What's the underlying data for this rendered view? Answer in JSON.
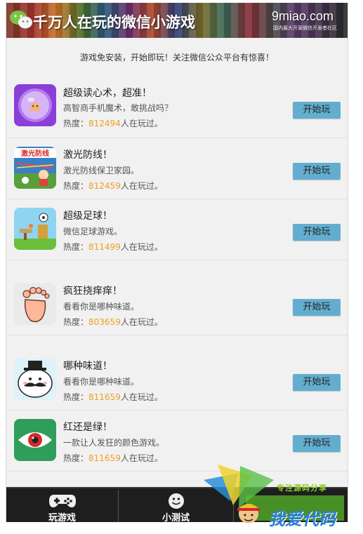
{
  "banner": {
    "title": "千万人在玩的微信小游戏",
    "logo": "9miao.com",
    "subtitle": "国内最大开源微信开发者社区"
  },
  "notice": "游戏免安装，开始即玩！关注微信公众平台有惊喜！",
  "games": [
    {
      "title": "超级读心术，超准！",
      "desc": "高智商手机魔术，敢挑战吗？",
      "heat_prefix": "热度：",
      "heat": "812494",
      "heat_suffix": "人在玩过。",
      "button": "开始玩",
      "icon": "crystal-ball-icon"
    },
    {
      "title": "激光防线！",
      "desc": "激光防线保卫家园。",
      "heat_prefix": "热度：",
      "heat": "812459",
      "heat_suffix": "人在玩过。",
      "button": "开始玩",
      "icon": "laser-defense-icon",
      "icon_text": "激光防线"
    },
    {
      "title": "超级足球！",
      "desc": "微信足球游戏。",
      "heat_prefix": "热度：",
      "heat": "811499",
      "heat_suffix": "人在玩过。",
      "button": "开始玩",
      "icon": "soccer-icon"
    },
    {
      "title": "疯狂挠痒痒！",
      "desc": "看看你是哪种味道。",
      "heat_prefix": "热度：",
      "heat": "803659",
      "heat_suffix": "人在玩过。",
      "button": "开始玩",
      "icon": "foot-icon"
    },
    {
      "title": "哪种味道！",
      "desc": "看看你是哪种味道。",
      "heat_prefix": "热度：",
      "heat": "811659",
      "heat_suffix": "人在玩过。",
      "button": "开始玩",
      "icon": "mustache-face-icon"
    },
    {
      "title": "红还是绿！",
      "desc": "一款让人发狂的颜色游戏。",
      "heat_prefix": "热度：",
      "heat": "811659",
      "heat_suffix": "人在玩过。",
      "button": "开始玩",
      "icon": "eye-icon"
    }
  ],
  "tabs": [
    {
      "label": "玩游戏",
      "icon": "gamepad-icon"
    },
    {
      "label": "小测试",
      "icon": "smiley-icon"
    }
  ],
  "watermark": {
    "line1": "专注源码分享",
    "line2": "我爱代码"
  },
  "colors": {
    "button_bg": "#63aecf",
    "heat_number": "#f0a020",
    "bottom_bar": "#1e1e1e"
  }
}
